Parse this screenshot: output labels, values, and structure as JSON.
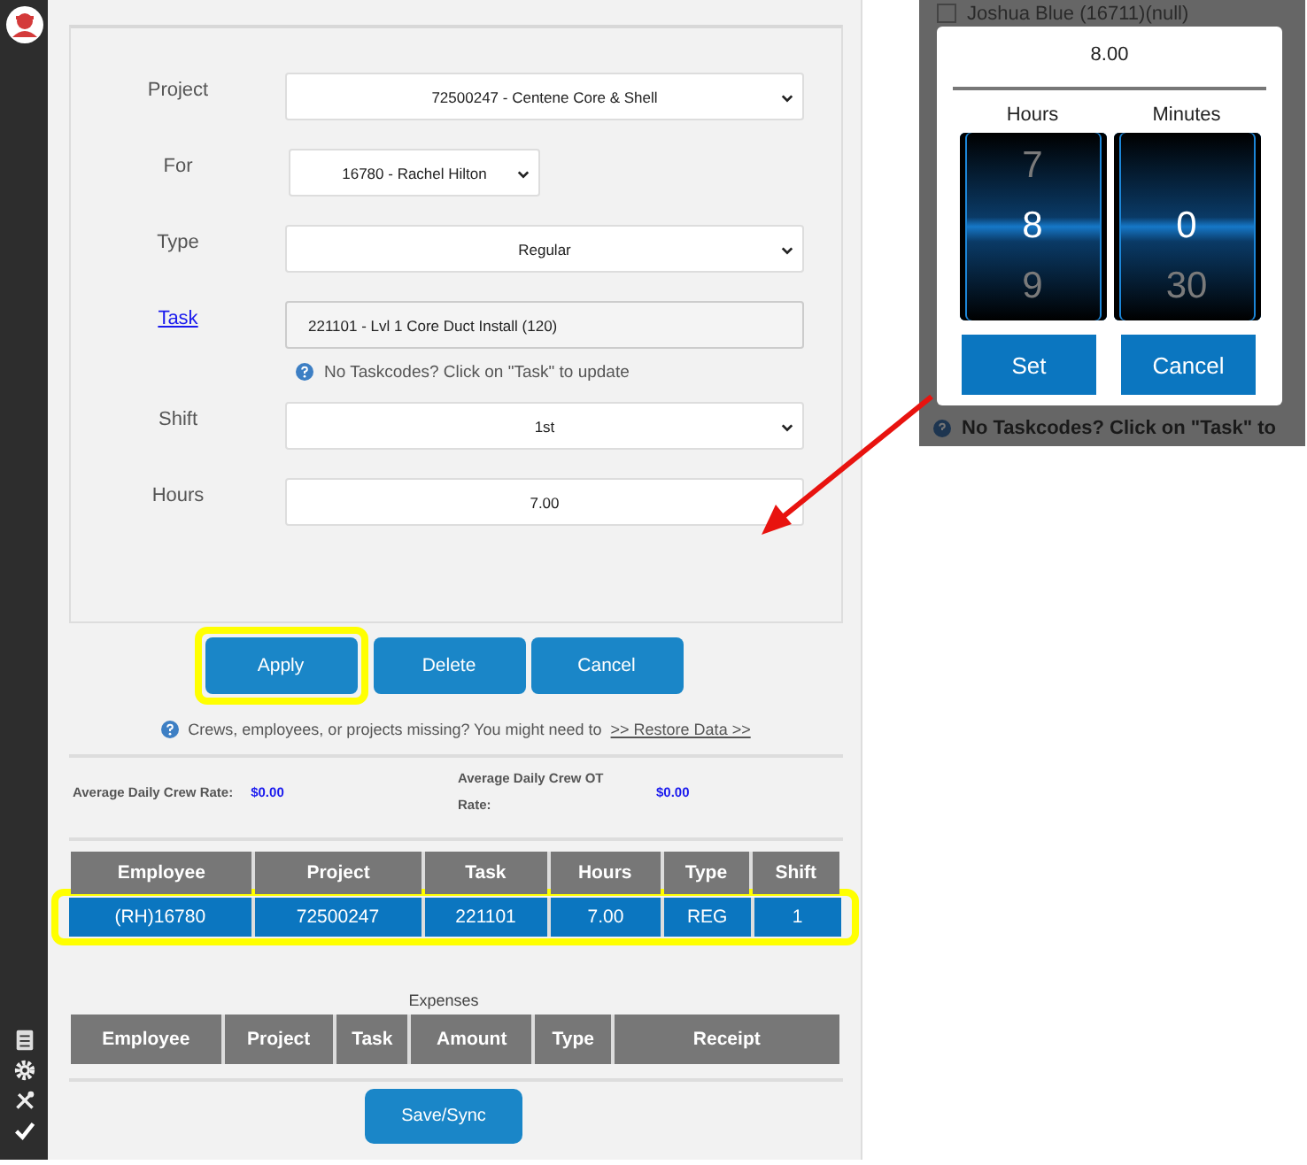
{
  "form": {
    "fields": [
      {
        "kind": "select",
        "label": "Project",
        "label_link": false,
        "value": "72500247 - Centene Core & Shell"
      },
      {
        "kind": "select_narrow",
        "label": "For",
        "label_link": false,
        "value": "16780 - Rachel Hilton"
      },
      {
        "kind": "select",
        "label": "Type",
        "label_link": false,
        "value": "Regular"
      },
      {
        "kind": "readonly",
        "label": "Task",
        "label_link": true,
        "value": "221101 - Lvl 1 Core Duct Install (120)"
      },
      {
        "kind": "hint",
        "text": "No Taskcodes? Click on \"Task\" to update"
      },
      {
        "kind": "select",
        "label": "Shift",
        "label_link": false,
        "value": "1st"
      },
      {
        "kind": "input",
        "label": "Hours",
        "label_link": false,
        "value": "7.00"
      }
    ]
  },
  "buttons": [
    {
      "label": "Apply",
      "highlighted": true
    },
    {
      "label": "Delete",
      "highlighted": false
    },
    {
      "label": "Cancel",
      "highlighted": false
    }
  ],
  "restore_hint": {
    "text": "Crews, employees, or projects missing? You might need to",
    "link": ">> Restore Data >>"
  },
  "rates": [
    {
      "label": "Average Daily Crew Rate:",
      "value": "$0.00"
    },
    {
      "label": "Average Daily Crew OT Rate:",
      "value": "$0.00"
    }
  ],
  "time_table": {
    "columns": [
      "Employee",
      "Project",
      "Task",
      "Hours",
      "Type",
      "Shift"
    ],
    "rows": [
      {
        "cells": [
          "(RH)16780",
          "72500247",
          "221101",
          "7.00",
          "REG",
          "1"
        ],
        "selected": true,
        "highlighted": true
      }
    ]
  },
  "expenses": {
    "title": "Expenses",
    "columns": [
      "Employee",
      "Project",
      "Task",
      "Amount",
      "Type",
      "Receipt"
    ]
  },
  "save_button": "Save/Sync",
  "inset": {
    "checked": false,
    "background_text": "Joshua Blue (16711)(null)",
    "footer_text": "No Taskcodes? Click on \"Task\" to",
    "picker": {
      "value": "8.00",
      "columns": [
        {
          "label": "Hours",
          "items": [
            {
              "label": "7",
              "selected": false
            },
            {
              "label": "8",
              "selected": true
            },
            {
              "label": "9",
              "selected": false
            }
          ]
        },
        {
          "label": "Minutes",
          "items": [
            {
              "label": "0",
              "selected": true
            },
            {
              "label": "30",
              "selected": false
            }
          ]
        }
      ],
      "buttons": [
        "Set",
        "Cancel"
      ]
    }
  }
}
